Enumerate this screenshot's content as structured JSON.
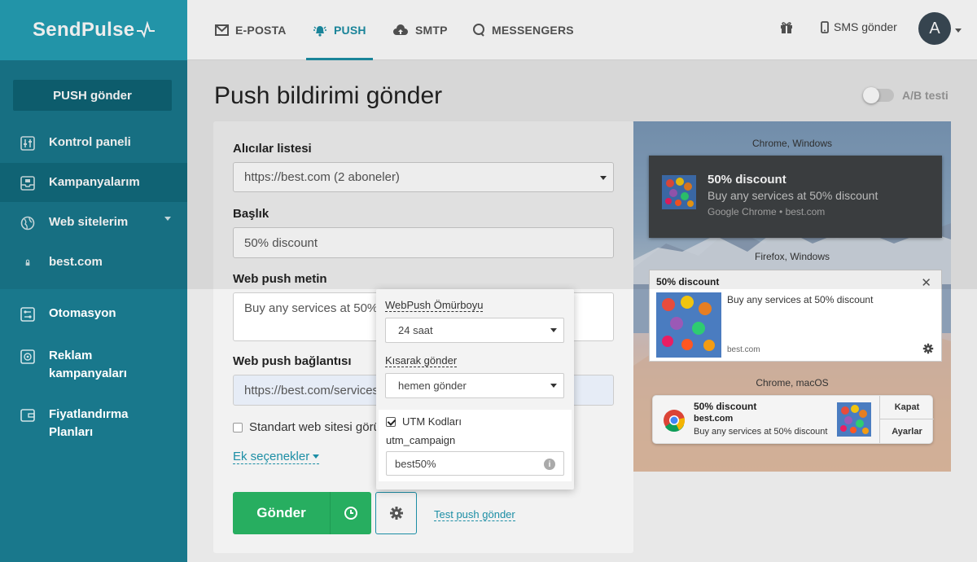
{
  "brand": {
    "name": "SendPulse"
  },
  "sidebar": {
    "push_send": "PUSH gönder",
    "items": [
      {
        "label": "Kontrol paneli"
      },
      {
        "label": "Kampanyalarım"
      },
      {
        "label": "Web sitelerim"
      },
      {
        "label": "best.com"
      },
      {
        "label": "Otomasyon"
      },
      {
        "label": "Reklam kampanyaları"
      },
      {
        "label": "Fiyatlandırma Planları"
      }
    ]
  },
  "topbar": {
    "tabs": [
      {
        "label": "E-POSTA",
        "icon": "envelope-icon"
      },
      {
        "label": "PUSH",
        "icon": "bell-icon"
      },
      {
        "label": "SMTP",
        "icon": "cloud-upload-icon"
      },
      {
        "label": "MESSENGERS",
        "icon": "chat-icon"
      }
    ],
    "sms_label": "SMS gönder",
    "avatar_letter": "A"
  },
  "page": {
    "title": "Push bildirimi gönder",
    "ab_label": "A/B testi"
  },
  "form": {
    "recipients_label": "Alıcılar listesi",
    "recipients_value": "https://best.com (2 aboneler)",
    "title_label": "Başlık",
    "title_value": "50% discount",
    "text_label": "Web push metin",
    "text_value": "Buy any services at 50% discount",
    "link_label": "Web push bağlantısı",
    "link_value": "https://best.com/services",
    "checkbox_label": "Standart web sitesi görüntüsü",
    "more_options": "Ek seçenekler",
    "send_label": "Gönder",
    "test_link": "Test push gönder"
  },
  "popup": {
    "lifetime_label": "WebPush Ömürboyu",
    "lifetime_value": "24 saat",
    "throttle_label": "Kısarak gönder",
    "throttle_value": "hemen gönder",
    "utm_label": "UTM Kodları",
    "utm_checked": true,
    "utm_campaign_label": "utm_campaign",
    "utm_campaign_value": "best50%"
  },
  "preview": {
    "chrome_win": {
      "platform": "Chrome, Windows",
      "title": "50% discount",
      "body": "Buy any services at 50% discount",
      "source": "Google Chrome • best.com"
    },
    "firefox_win": {
      "platform": "Firefox, Windows",
      "title": "50% discount",
      "body": "Buy any services at 50% discount",
      "source": "best.com"
    },
    "chrome_mac": {
      "platform": "Chrome, macOS",
      "title": "50% discount",
      "domain": "best.com",
      "body": "Buy any services at 50% discount",
      "action1": "Kapat",
      "action2": "Ayarlar"
    }
  },
  "colors": {
    "accent": "#1c8ea5",
    "sidebar": "#19788c",
    "send": "#27ae60"
  }
}
